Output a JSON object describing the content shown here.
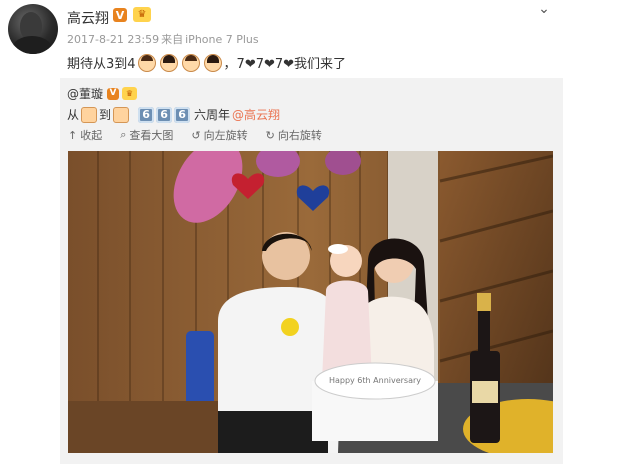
{
  "post": {
    "author": "高云翔",
    "meta_time": "2017-8-21 23:59",
    "meta_from": "来自",
    "meta_device": "iPhone 7 Plus",
    "text_prefix": "期待从3到4",
    "text_suffix": "，7❤7❤7❤我们来了",
    "emoji_count": 4
  },
  "repost": {
    "author": "@董璇",
    "text_from": "从",
    "text_to": "到",
    "keycaps": [
      "6",
      "6",
      "6"
    ],
    "text_suffix": "六周年",
    "mention": "@高云翔",
    "actions": {
      "collect": "收起",
      "view_large": "查看大图",
      "rotate_left": "向左旋转",
      "rotate_right": "向右旋转"
    },
    "cake_text": "Happy 6th Anniversary"
  },
  "colors": {
    "badge_orange": "#e8831f",
    "mention": "#eb7350",
    "repost_bg": "#f2f2f2"
  },
  "icons": {
    "menu": "chevron-down-icon",
    "collect": "collapse-arrow-icon",
    "view_large": "magnifier-icon",
    "rotate_left": "rotate-left-icon",
    "rotate_right": "rotate-right-icon"
  }
}
